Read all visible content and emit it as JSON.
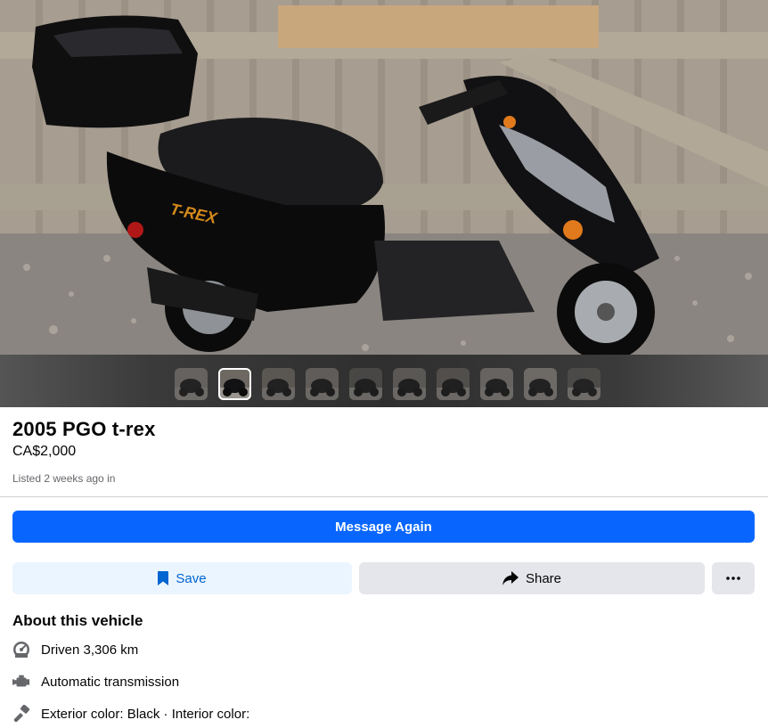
{
  "listing": {
    "title": "2005 PGO t-rex",
    "price": "CA$2,000",
    "listed": "Listed 2 weeks ago in"
  },
  "gallery": {
    "photo_count": 10,
    "active_index": 1
  },
  "actions": {
    "message_label": "Message Again",
    "save_label": "Save",
    "share_label": "Share",
    "more_icon": "more-dots-icon"
  },
  "about": {
    "heading": "About this vehicle",
    "specs": [
      {
        "icon": "odometer-icon",
        "text": "Driven 3,306 km"
      },
      {
        "icon": "engine-icon",
        "text": "Automatic transmission"
      },
      {
        "icon": "paint-icon",
        "text": "Exterior color: Black · Interior color:"
      }
    ]
  },
  "colors": {
    "primary": "#0866ff",
    "save_bg": "#ebf5ff",
    "save_text": "#0064d1",
    "secondary_bg": "#e4e6eb"
  }
}
